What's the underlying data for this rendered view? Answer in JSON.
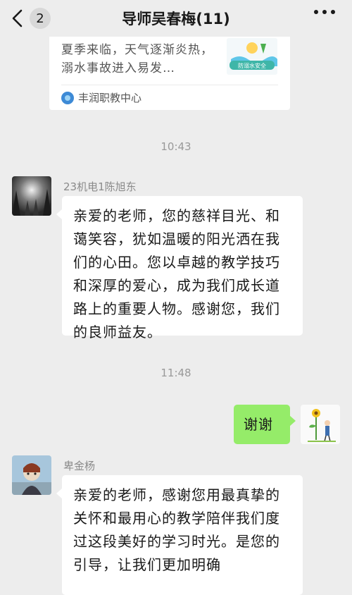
{
  "header": {
    "title": "导师吴春梅(11)",
    "unread_count": "2"
  },
  "shared_card": {
    "description": "夏季来临，天气逐渐炎热，溺水事故进入易发…",
    "thumb_text": "防溺水安全",
    "source": "丰润职教中心"
  },
  "messages": [
    {
      "time": "10:43"
    },
    {
      "sender": "23机电1陈旭东",
      "text": "亲爱的老师，您的慈祥目光、和蔼笑容，犹如温暖的阳光洒在我们的心田。您以卓越的教学技巧和深厚的爱心，成为我们成长道路上的重要人物。感谢您，我们的良师益友。"
    },
    {
      "time": "11:48"
    },
    {
      "self": true,
      "text": "谢谢"
    },
    {
      "sender": "卑金杨",
      "text": "亲爱的老师，感谢您用最真挚的关怀和最用心的教学陪伴我们度过这段美好的学习时光。是您的引导，让我们更加明确"
    }
  ],
  "colors": {
    "background": "#ededed",
    "bubble_other": "#ffffff",
    "bubble_self": "#95ec69"
  }
}
